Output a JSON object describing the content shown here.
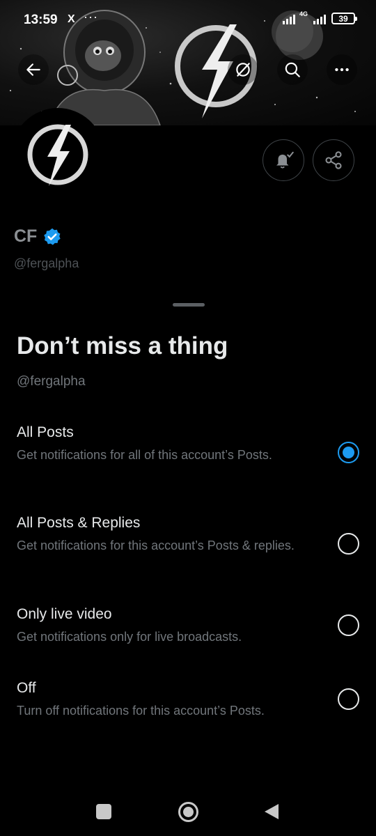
{
  "status_bar": {
    "time": "13:59",
    "app_icon": "X",
    "more_indicator": "···",
    "network": "4G",
    "battery": "39"
  },
  "header": {
    "back_icon": "arrow-left-icon",
    "grok_icon": "grok-icon",
    "search_icon": "search-icon",
    "more_icon": "more-horizontal-icon"
  },
  "profile": {
    "name": "CF",
    "verified": true,
    "handle": "@fergalpha",
    "notification_button_icon": "bell-check-icon",
    "share_button_icon": "share-icon"
  },
  "sheet": {
    "title": "Don’t miss a thing",
    "handle": "@fergalpha",
    "options": [
      {
        "title": "All Posts",
        "description": "Get notifications for all of this account’s Posts.",
        "selected": true
      },
      {
        "title": "All Posts & Replies",
        "description": "Get notifications for this account’s Posts & replies.",
        "selected": false
      },
      {
        "title": "Only live video",
        "description": "Get notifications only for live broadcasts.",
        "selected": false
      },
      {
        "title": "Off",
        "description": "Turn off notifications for this account’s Posts.",
        "selected": false
      }
    ]
  },
  "colors": {
    "accent": "#1d9bf0",
    "background": "#000000",
    "primary_text": "#e7e9ea",
    "secondary_text": "#71767b"
  }
}
